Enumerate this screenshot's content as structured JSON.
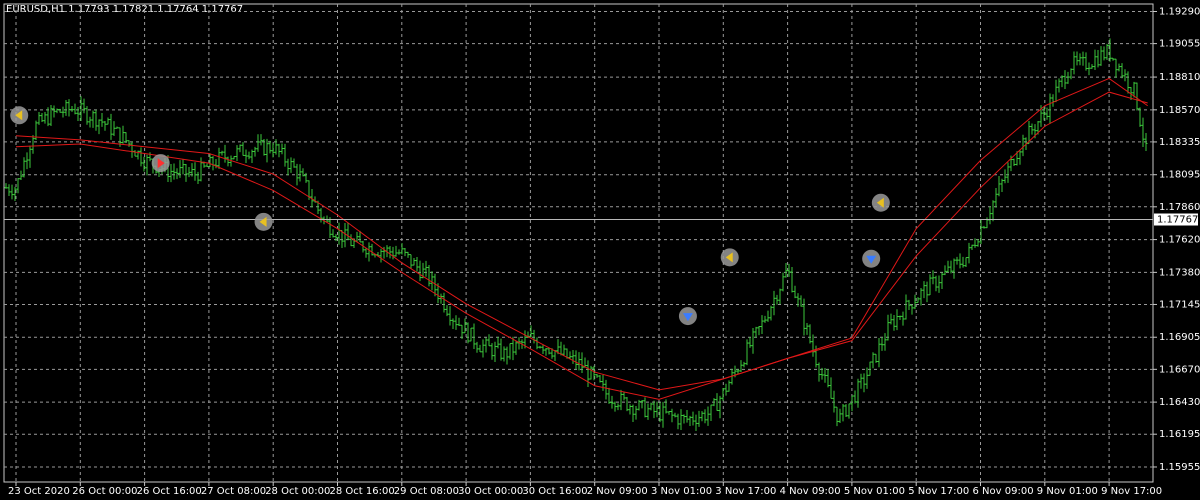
{
  "symbol_info": "EURUSD,H1  1.17793 1.17821 1.17764 1.17767",
  "colors": {
    "background": "#000000",
    "bars": "#3cc83c",
    "ma": "#e01818",
    "grid": "#9a9a9a",
    "price_line": "#b8b8b8",
    "text": "#ffffff"
  },
  "icons": [
    "signal-arrow-left-icon",
    "signal-arrow-down-icon",
    "signal-arrow-right-icon"
  ],
  "chart_data": {
    "type": "ohlc",
    "title": "EURUSD,H1",
    "ohlc_header": {
      "open": 1.17793,
      "high": 1.17821,
      "low": 1.17764,
      "close": 1.17767
    },
    "ylim": [
      1.15845,
      1.19345
    ],
    "y_ticks": [
      "1.19290",
      "1.19055",
      "1.18810",
      "1.18570",
      "1.18335",
      "1.18095",
      "1.17860",
      "1.17620",
      "1.17380",
      "1.17145",
      "1.16905",
      "1.16670",
      "1.16430",
      "1.16195",
      "1.15955"
    ],
    "x_ticks": [
      "23 Oct 2020",
      "26 Oct 00:00",
      "26 Oct 16:00",
      "27 Oct 08:00",
      "28 Oct 00:00",
      "28 Oct 16:00",
      "29 Oct 08:00",
      "30 Oct 00:00",
      "30 Oct 16:00",
      "2 Nov 09:00",
      "3 Nov 01:00",
      "3 Nov 17:00",
      "4 Nov 09:00",
      "5 Nov 01:00",
      "5 Nov 17:00",
      "6 Nov 09:00",
      "9 Nov 01:00",
      "9 Nov 17:00"
    ],
    "current_price": "1.17767",
    "grid": true,
    "series": [
      {
        "type": "bars",
        "x": [
          "23 Oct 2020",
          "26 Oct 00:00",
          "26 Oct 16:00",
          "27 Oct 08:00",
          "28 Oct 00:00",
          "28 Oct 16:00",
          "29 Oct 08:00",
          "30 Oct 00:00",
          "30 Oct 16:00",
          "2 Nov 09:00",
          "3 Nov 01:00",
          "3 Nov 17:00",
          "4 Nov 09:00",
          "5 Nov 01:00",
          "5 Nov 17:00",
          "6 Nov 09:00",
          "9 Nov 01:00",
          "9 Nov 17:00"
        ],
        "close_path_x": [
          0,
          0.3,
          0.6,
          0.9,
          1.3,
          1.7,
          2.0,
          2.4,
          2.8,
          3.2,
          3.6,
          4.0,
          4.4,
          4.8,
          5.2,
          5.6,
          6.0,
          6.4,
          6.8,
          7.2,
          7.6,
          8.0,
          8.4,
          8.8,
          9.2,
          9.6,
          10.0,
          10.4,
          10.8,
          11.0,
          11.3,
          11.6,
          12.0,
          12.4,
          12.8,
          13.2,
          13.6,
          14.0,
          14.4,
          14.8,
          15.2,
          15.6,
          16.0,
          16.4,
          16.6,
          17.0,
          17.4,
          17.6
        ],
        "close_path_y": [
          1.18,
          1.1845,
          1.1855,
          1.1858,
          1.185,
          1.1835,
          1.182,
          1.1812,
          1.181,
          1.1822,
          1.1828,
          1.183,
          1.181,
          1.1775,
          1.176,
          1.1755,
          1.1752,
          1.1735,
          1.1705,
          1.1685,
          1.1678,
          1.169,
          1.168,
          1.167,
          1.1648,
          1.164,
          1.1635,
          1.163,
          1.1635,
          1.165,
          1.1675,
          1.17,
          1.174,
          1.168,
          1.163,
          1.166,
          1.17,
          1.172,
          1.1735,
          1.175,
          1.179,
          1.183,
          1.1855,
          1.189,
          1.189,
          1.19,
          1.187,
          1.182
        ]
      },
      {
        "type": "line",
        "name": "",
        "color": "#e01818",
        "x": [
          0,
          1,
          2,
          3,
          4,
          5,
          6,
          7,
          8,
          9,
          10,
          11,
          12,
          13,
          14,
          15,
          16,
          17,
          17.6
        ],
        "y": [
          1.1838,
          1.1835,
          1.183,
          1.1825,
          1.181,
          1.178,
          1.1745,
          1.1715,
          1.169,
          1.1665,
          1.1652,
          1.166,
          1.1675,
          1.169,
          1.177,
          1.182,
          1.186,
          1.188,
          1.186
        ]
      },
      {
        "type": "line",
        "name": "",
        "color": "#e01818",
        "x": [
          0,
          1,
          2,
          3,
          4,
          5,
          6,
          7,
          8,
          9,
          10,
          11,
          12,
          13,
          14,
          15,
          16,
          17,
          17.6
        ],
        "y": [
          1.183,
          1.1832,
          1.1825,
          1.1818,
          1.1798,
          1.177,
          1.1738,
          1.1708,
          1.1682,
          1.1655,
          1.1645,
          1.166,
          1.1675,
          1.1688,
          1.175,
          1.18,
          1.1845,
          1.187,
          1.1862
        ]
      }
    ],
    "markers": [
      {
        "icon": "signal-arrow-left-icon",
        "x": 0.05,
        "y": 1.1853
      },
      {
        "icon": "signal-arrow-right-icon",
        "x": 2.25,
        "y": 1.1818
      },
      {
        "icon": "signal-arrow-left-icon",
        "x": 3.85,
        "y": 1.1775
      },
      {
        "icon": "signal-arrow-down-icon",
        "x": 10.45,
        "y": 1.1706
      },
      {
        "icon": "signal-arrow-left-icon",
        "x": 11.1,
        "y": 1.1749
      },
      {
        "icon": "signal-arrow-down-icon",
        "x": 13.3,
        "y": 1.1748
      },
      {
        "icon": "signal-arrow-left-icon",
        "x": 13.45,
        "y": 1.1789
      }
    ]
  }
}
